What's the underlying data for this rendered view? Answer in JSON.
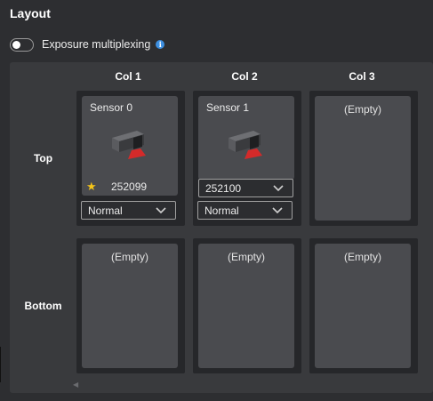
{
  "section": {
    "title": "Layout"
  },
  "exposure": {
    "label": "Exposure multiplexing",
    "enabled": false,
    "info_icon": "info-icon"
  },
  "grid": {
    "columns": [
      "Col 1",
      "Col 2",
      "Col 3"
    ],
    "rows": [
      "Top",
      "Bottom"
    ],
    "empty_label": "(Empty)",
    "cells": {
      "top_col1": {
        "sensor_name": "Sensor 0",
        "serial": "252099",
        "primary_icon": "star-icon",
        "mode": "Normal"
      },
      "top_col2": {
        "sensor_name": "Sensor 1",
        "serial": "252100",
        "mode": "Normal"
      }
    }
  },
  "colors": {
    "accent_info": "#3d8fe0",
    "star": "#f5c518",
    "laser_red": "#d42a2a"
  }
}
